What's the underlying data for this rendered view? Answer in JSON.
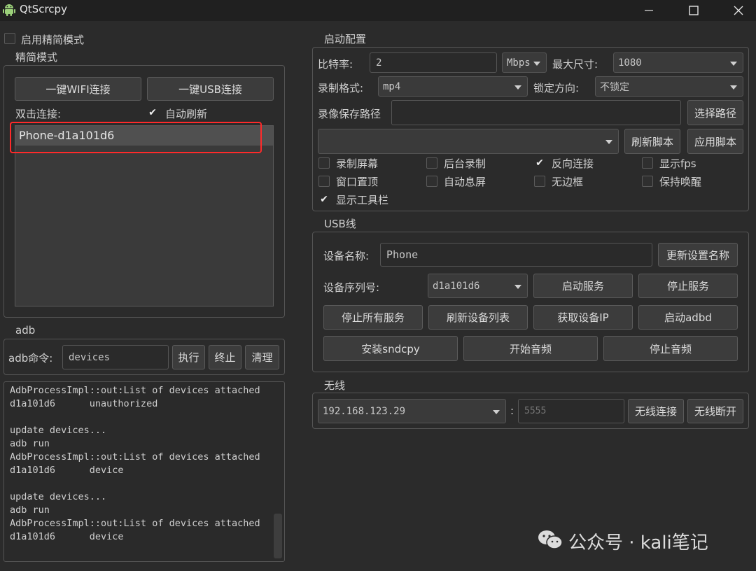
{
  "window": {
    "title": "QtScrcpy"
  },
  "left": {
    "simple_mode_label": "启用精简模式",
    "simple_mode_group": "精简模式",
    "wifi_connect_button": "一键WIFI连接",
    "usb_connect_button": "一键USB连接",
    "double_click_label": "双击连接:",
    "auto_refresh_label": "自动刷新",
    "auto_refresh_checked": true,
    "devices": [
      "Phone-d1a101d6"
    ]
  },
  "adb": {
    "group_title": "adb",
    "command_label": "adb命令:",
    "command_value": "devices",
    "execute_button": "执行",
    "stop_button": "终止",
    "clear_button": "清理",
    "log_lines": [
      "AdbProcessImpl::out:List of devices attached",
      "d1a101d6      unauthorized",
      "",
      "update devices...",
      "adb run",
      "AdbProcessImpl::out:List of devices attached",
      "d1a101d6      device",
      "",
      "update devices...",
      "adb run",
      "AdbProcessImpl::out:List of devices attached",
      "d1a101d6      device"
    ]
  },
  "start_config": {
    "group_title": "启动配置",
    "bitrate_label": "比特率:",
    "bitrate_value": "2",
    "bitrate_unit": "Mbps",
    "max_size_label": "最大尺寸:",
    "max_size_value": "1080",
    "record_format_label": "录制格式:",
    "record_format_value": "mp4",
    "lock_orientation_label": "锁定方向:",
    "lock_orientation_value": "不锁定",
    "record_path_label": "录像保存路径",
    "record_path_value": "",
    "select_path_button": "选择路径",
    "script_value": "",
    "refresh_script_button": "刷新脚本",
    "apply_script_button": "应用脚本",
    "options": [
      {
        "label": "录制屏幕",
        "checked": false
      },
      {
        "label": "后台录制",
        "checked": false
      },
      {
        "label": "反向连接",
        "checked": true
      },
      {
        "label": "显示fps",
        "checked": false
      },
      {
        "label": "窗口置顶",
        "checked": false
      },
      {
        "label": "自动息屏",
        "checked": false
      },
      {
        "label": "无边框",
        "checked": false
      },
      {
        "label": "保持唤醒",
        "checked": false
      },
      {
        "label": "显示工具栏",
        "checked": true
      }
    ]
  },
  "usb": {
    "group_title": "USB线",
    "device_name_label": "设备名称:",
    "device_name_value": "Phone",
    "update_name_button": "更新设置名称",
    "serial_label": "设备序列号:",
    "serial_value": "d1a101d6",
    "start_service_button": "启动服务",
    "stop_service_button": "停止服务",
    "stop_all_button": "停止所有服务",
    "refresh_devices_button": "刷新设备列表",
    "get_ip_button": "获取设备IP",
    "start_adbd_button": "启动adbd",
    "install_sndcpy_button": "安装sndcpy",
    "start_audio_button": "开始音频",
    "stop_audio_button": "停止音频"
  },
  "wireless": {
    "group_title": "无线",
    "ip_value": "192.168.123.29",
    "colon": ":",
    "port_placeholder": "5555",
    "connect_button": "无线连接",
    "disconnect_button": "无线断开"
  },
  "watermark": {
    "text": "公众号 · kali笔记"
  },
  "colors": {
    "selection_highlight": "#ff2a2a",
    "background": "#2b2b2b",
    "titlebar": "#202020"
  },
  "icons": {
    "app": "android-icon",
    "wechat": "wechat-icon"
  }
}
